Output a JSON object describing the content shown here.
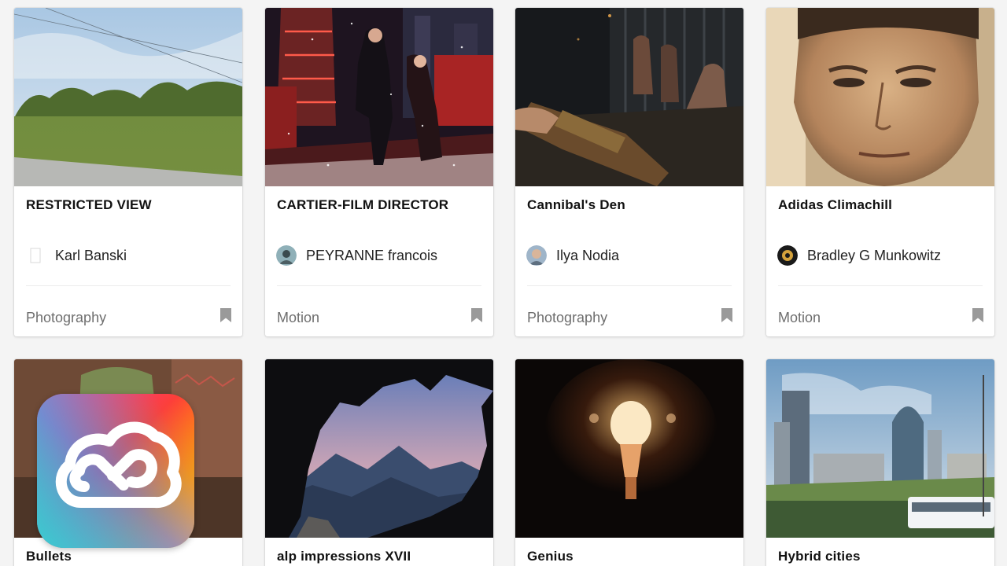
{
  "cards": [
    {
      "title": "RESTRICTED VIEW",
      "owner": "Karl Banski",
      "field": "Photography"
    },
    {
      "title": "CARTIER-FILM DIRECTOR",
      "owner": "PEYRANNE francois",
      "field": "Motion"
    },
    {
      "title": "Cannibal's Den",
      "owner": "Ilya Nodia",
      "field": "Photography"
    },
    {
      "title": "Adidas Climachill",
      "owner": "Bradley G Munkowitz",
      "field": "Motion"
    },
    {
      "title": "Bullets"
    },
    {
      "title": "alp impressions XVII"
    },
    {
      "title": "Genius"
    },
    {
      "title": "Hybrid cities"
    }
  ],
  "icons": {
    "bookmark": "bookmark-icon",
    "logo": "adobe-creative-cloud-logo"
  },
  "colors": {
    "bookmark": "#9a9a9a",
    "page_bg": "#f4f4f4"
  }
}
